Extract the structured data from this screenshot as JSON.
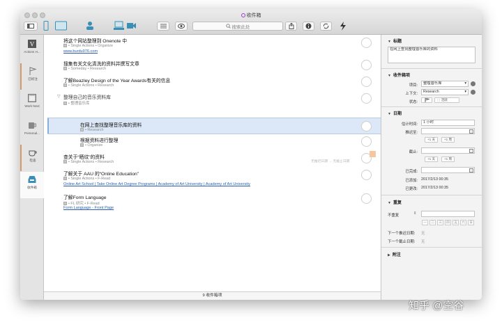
{
  "window": {
    "title": "收件箱"
  },
  "toolbar": {
    "search_placeholder": "搜索此处"
  },
  "sidebar": {
    "items": [
      {
        "label": "Actions H..."
      },
      {
        "label": "已标注"
      },
      {
        "label": "Work Next"
      },
      {
        "label": "Personal..."
      },
      {
        "label": "检查"
      },
      {
        "label": "收件箱"
      }
    ]
  },
  "outline": {
    "rows": [
      {
        "title": "将这个网站整理到 Onenote 中",
        "meta": "• Single Actions • Organize",
        "link": "www.burdu976.com"
      },
      {
        "title": "搜集有关文化清洗的资料并撰写文章",
        "meta": "• Someday • Research"
      },
      {
        "title": "了解Beazley Design of the Year Awards有关的信息",
        "meta": "• Single Actions • Research"
      },
      {
        "title": "整理自己的音乐资料库",
        "meta": "• 整理音乐库"
      },
      {
        "title": "在网上查找整理音乐库的资料",
        "meta": "• Research"
      },
      {
        "title": "根据资料进行整理",
        "meta": "• Organize"
      },
      {
        "title": "查关于“晒纹”的资料",
        "meta": "• Single Actions • Research",
        "dates": "无推迟日期 → 无截止日期"
      },
      {
        "title": "了解关于 AAU 的“Online Education”",
        "meta": "• Single Actions • F-Read",
        "link": "Online Art School | Take Online Art Degree Programs | Academy of Art University | Academy of Art University"
      },
      {
        "title": "了解Form Language",
        "meta": "• FL 研究 • F-Read",
        "link": "Form Language - Front Page"
      }
    ],
    "footer": "9 收件箱项"
  },
  "inspector": {
    "title_section": "标题",
    "title_value": "在网上查找整理音乐库的资料",
    "inbox_section": "收件箱项",
    "project_label": "项目:",
    "project_value": "整理音乐库",
    "context_label": "上下文:",
    "context_value": "Research",
    "status_label": "状态:",
    "status_value": "活跃",
    "dates_section": "日期",
    "estimate_label": "估计时间:",
    "estimate_value": "1 小时",
    "defer_label": "推迟至:",
    "due_label": "截止:",
    "btn_day1": "+1 天",
    "btn_week1": "+1 周",
    "btn_day2": "+1 天",
    "btn_week2": "+1 周",
    "completed_label": "已完成:",
    "added_label": "已添加:",
    "added_value": "2017/2/13 00:35",
    "changed_label": "已更改:",
    "changed_value": "2017/2/13 00:35",
    "repeat_section": "重复",
    "repeat_value": "不重复",
    "weekdays": [
      "一",
      "二",
      "三",
      "四",
      "五",
      "六",
      "日"
    ],
    "next_defer_label": "下一个推迟日期:",
    "next_defer_value": "无",
    "next_due_label": "下一个截止日期:",
    "next_due_value": "无",
    "notes_section": "附注"
  },
  "watermark": "知乎 @空谷",
  "colors": {
    "selection": "#dce8f7",
    "link": "#2a5db0",
    "flag": "#f4c7a0",
    "status_purple": "#9b3bd0"
  }
}
